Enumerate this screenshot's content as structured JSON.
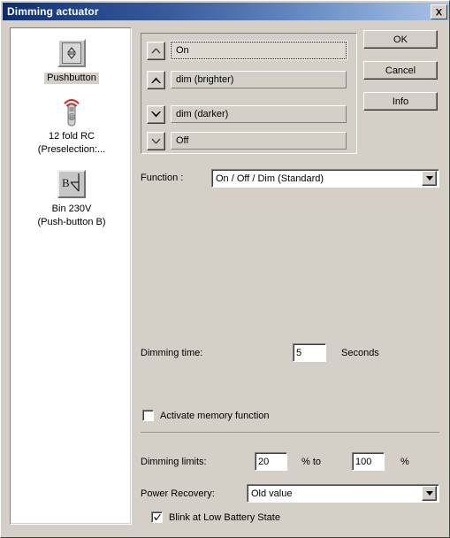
{
  "window": {
    "title": "Dimming actuator",
    "close_icon": "close-icon"
  },
  "sidebar": {
    "devices": [
      {
        "icon": "pushbutton-icon",
        "label_lines": [
          "Pushbutton"
        ],
        "selected": true
      },
      {
        "icon": "remote-control-icon",
        "label_lines": [
          "12 fold RC",
          "(Preselection:..."
        ],
        "selected": false
      },
      {
        "icon": "binary-input-icon",
        "label_lines": [
          "Bin 230V",
          "(Push-button B)"
        ],
        "selected": false
      }
    ]
  },
  "action_list": {
    "rows": [
      {
        "arrow": "chevron-up-thin-icon",
        "label": "On",
        "selected": true
      },
      {
        "arrow": "chevron-up-bold-icon",
        "label": "dim (brighter)",
        "selected": false
      },
      {
        "arrow": "chevron-down-bold-icon",
        "label": "dim (darker)",
        "selected": false
      },
      {
        "arrow": "chevron-down-thin-icon",
        "label": "Off",
        "selected": false
      }
    ]
  },
  "buttons": {
    "ok": "OK",
    "cancel": "Cancel",
    "info": "Info"
  },
  "form": {
    "function_label": "Function :",
    "function_value": "On / Off / Dim (Standard)",
    "dimming_time_label": "Dimming time:",
    "dimming_time_value": "5",
    "dimming_time_unit": "Seconds",
    "memory_checkbox_label": "Activate memory function",
    "memory_checkbox_checked": false,
    "dimming_limits_label": "Dimming limits:",
    "dimming_limit_min": "20",
    "dimming_limits_middle_unit": "% to",
    "dimming_limit_max": "100",
    "dimming_limits_end_unit": "%",
    "power_recovery_label": "Power Recovery:",
    "power_recovery_value": "Old value",
    "blink_checkbox_label": "Blink at Low Battery State",
    "blink_checkbox_checked": true
  },
  "colors": {
    "dialog_face": "#d4d0c8",
    "title_start": "#0a2b70",
    "title_end": "#a9c3e4",
    "signal_red": "#e02020"
  }
}
